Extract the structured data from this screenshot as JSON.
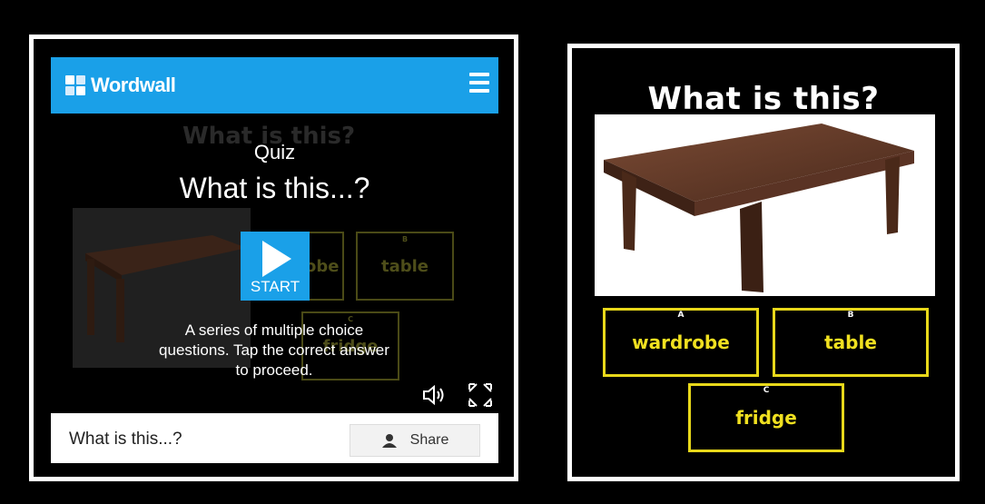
{
  "left_panel": {
    "brand": "Wordwall",
    "activity": {
      "type": "Quiz",
      "title": "What is this...?",
      "start_label": "START",
      "description": "A series of multiple choice questions. Tap the correct answer to proceed.",
      "background_title": "What is this?",
      "background_answers": [
        {
          "letter": "A",
          "text": "wardrobe"
        },
        {
          "letter": "B",
          "text": "table"
        },
        {
          "letter": "C",
          "text": "fridge"
        }
      ]
    },
    "footer": {
      "title": "What is this...?",
      "share_label": "Share"
    },
    "colors": {
      "brand_blue": "#1aa0e8"
    },
    "icons": [
      "menu-icon",
      "play-icon",
      "sound-icon",
      "fullscreen-icon",
      "person-icon"
    ]
  },
  "right_panel": {
    "question": "What is this?",
    "answers": [
      {
        "letter": "A",
        "text": "wardrobe"
      },
      {
        "letter": "B",
        "text": "table"
      },
      {
        "letter": "C",
        "text": "fridge"
      }
    ],
    "colors": {
      "answer_border": "#e8d81a",
      "answer_text": "#f0e020"
    }
  }
}
